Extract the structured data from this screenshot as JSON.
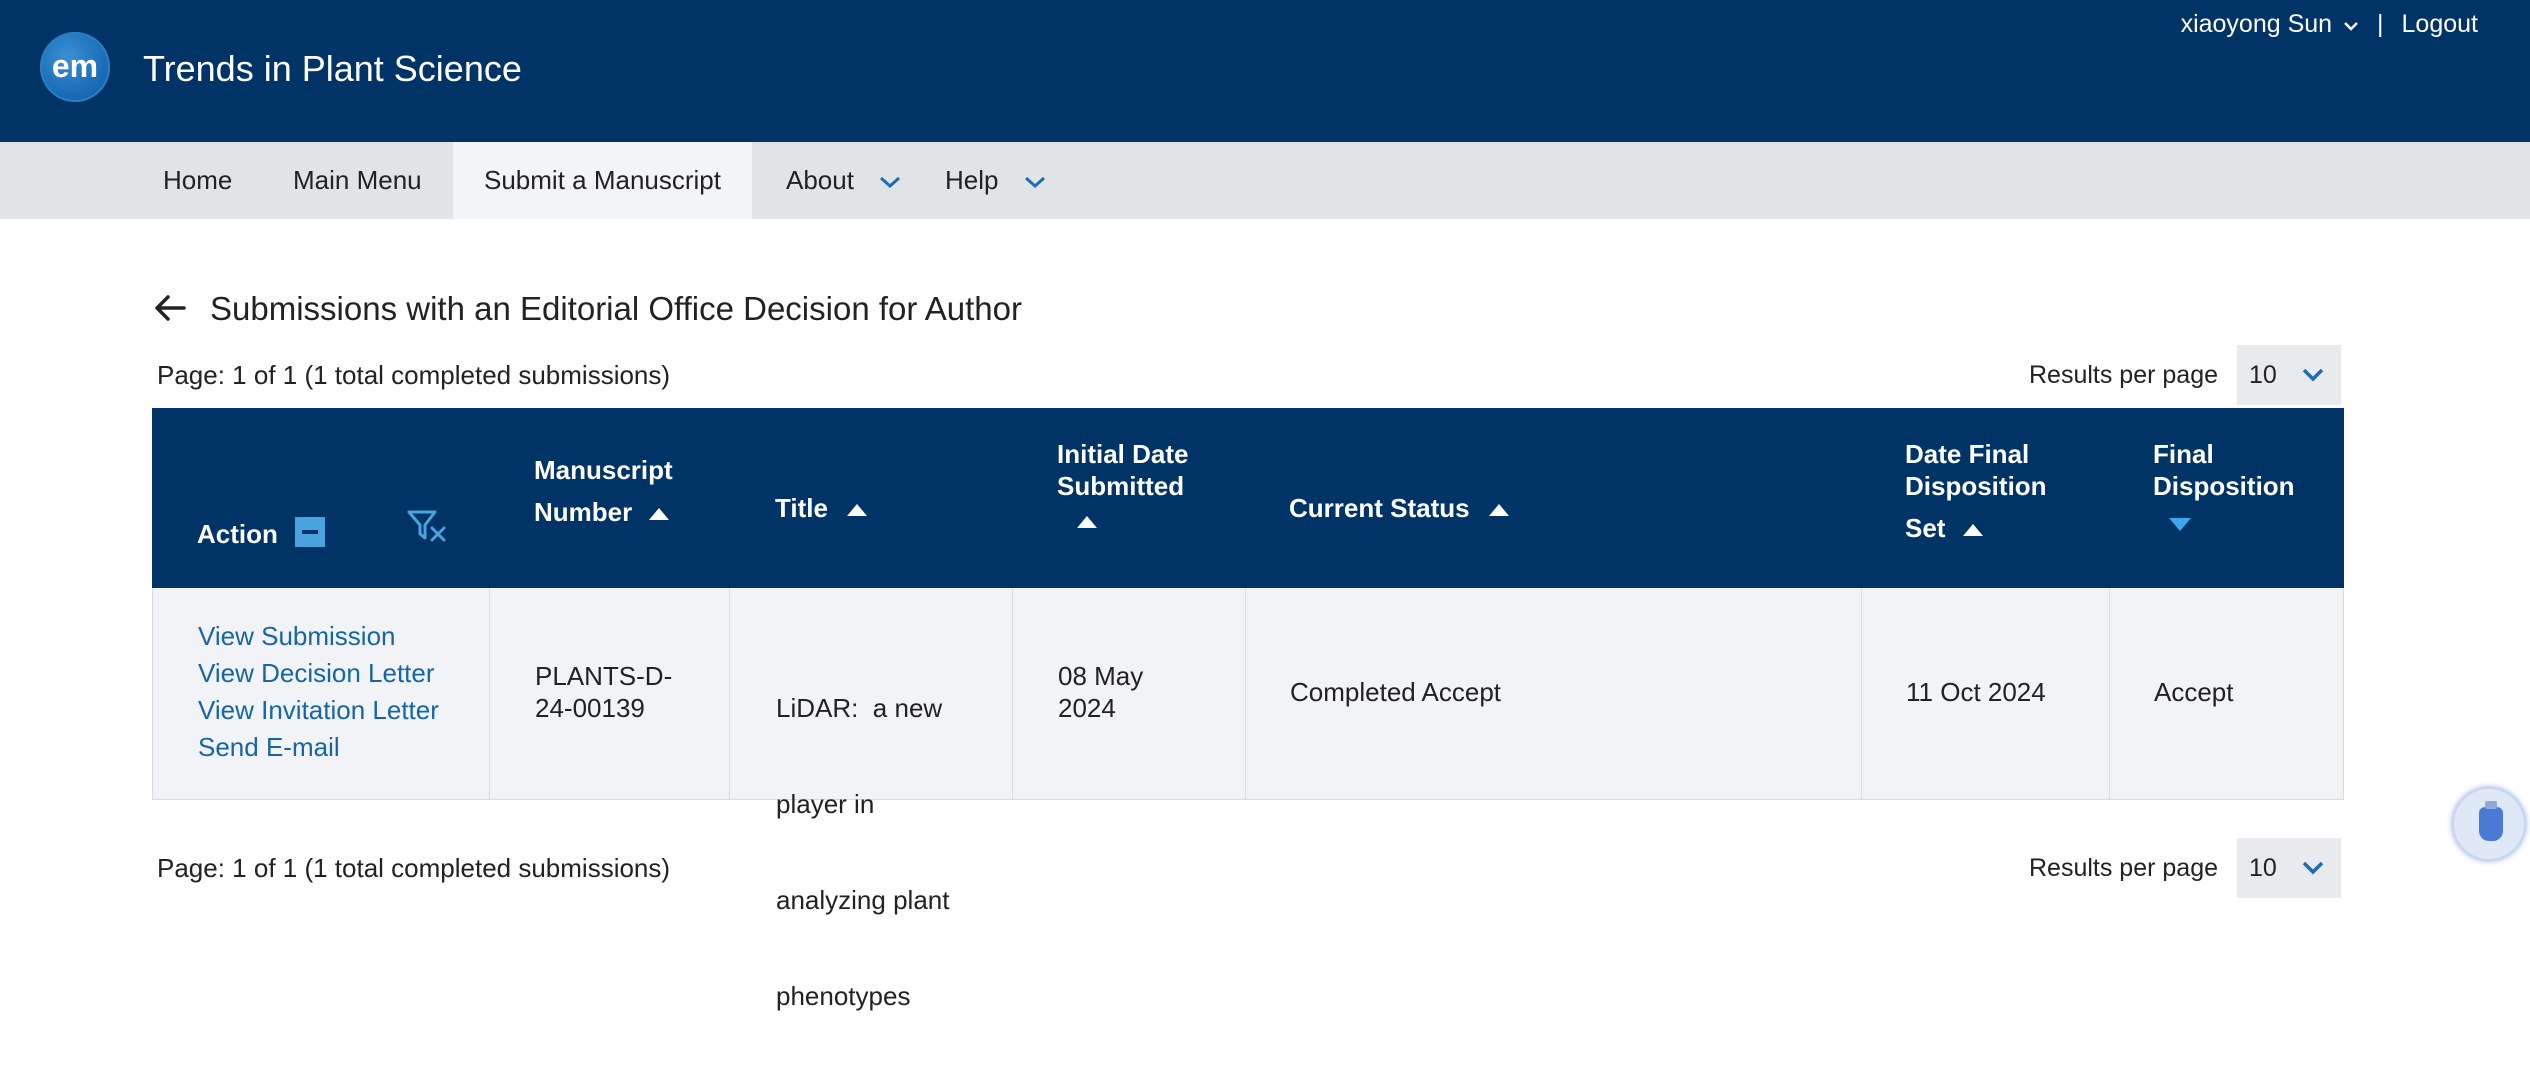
{
  "header": {
    "logo_text": "em",
    "journal_name": "Trends in Plant Science",
    "user_name": "xiaoyong Sun",
    "separator": "|",
    "logout_label": "Logout"
  },
  "nav": {
    "items": [
      {
        "label": "Home"
      },
      {
        "label": "Main Menu"
      },
      {
        "label": "Submit a Manuscript"
      },
      {
        "label": "About"
      },
      {
        "label": "Help"
      }
    ]
  },
  "page": {
    "title": "Submissions with an Editorial Office Decision for Author",
    "page_info_top": "Page: 1 of 1 (1 total completed submissions)",
    "page_info_bottom": "Page: 1 of 1 (1 total completed submissions)",
    "results_per_page_label": "Results per page",
    "results_per_page_value": "10"
  },
  "table": {
    "headers": {
      "action": "Action",
      "manuscript_number_line1": "Manuscript",
      "manuscript_number_line2": "Number",
      "title": "Title",
      "initial_date_line1": "Initial Date",
      "initial_date_line2": "Submitted",
      "current_status": "Current Status",
      "date_final_line1": "Date Final",
      "date_final_line2": "Disposition",
      "date_final_line3": "Set",
      "final_disposition_line1": "Final",
      "final_disposition_line2": "Disposition"
    },
    "rows": [
      {
        "actions": [
          "View Submission",
          "View Decision Letter",
          "View Invitation Letter",
          "Send E-mail"
        ],
        "manuscript_number_line1": "PLANTS-D-",
        "manuscript_number_line2": "24-00139",
        "title_lines": [
          "LiDAR:  a new",
          "player in",
          "analyzing plant",
          "phenotypes"
        ],
        "initial_date_line1": "08 May",
        "initial_date_line2": "2024",
        "current_status": "Completed Accept",
        "date_final": "11 Oct 2024",
        "final_disposition": "Accept"
      }
    ]
  },
  "colors": {
    "header_bg": "#003366",
    "nav_bg": "#e1e4e7",
    "link": "#1565a8",
    "accent": "#3aa8ee"
  },
  "icons": {
    "back": "arrow-left-icon",
    "filter_clear": "filter-clear-icon",
    "collapse": "minus-square-icon",
    "floating": "plug-icon"
  }
}
